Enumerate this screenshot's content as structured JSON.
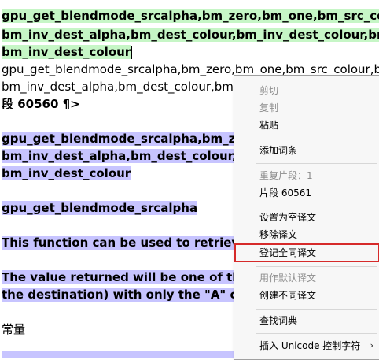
{
  "document": {
    "lines": [
      {
        "text": "gpu_get_blendmode_srcalpha,bm_zero,bm_one,bm_src_colo",
        "style": "bold-green"
      },
      {
        "text": "bm_inv_dest_alpha,bm_dest_colour,bm_inv_dest_colour,bm",
        "style": "bold-green"
      },
      {
        "text": "bm_inv_dest_colour",
        "style": "bold-green"
      },
      {
        "text": "gpu_get_blendmode_srcalpha,bm_zero,bm_one,bm_src_colour,b",
        "style": "plain"
      },
      {
        "text": "bm_inv_dest_alpha,bm_dest_colour,bm",
        "style": "plain"
      },
      {
        "text": "段 60560 ¶>",
        "style": "bold"
      },
      {
        "text": "gpu_get_blendmode_srcalpha,bm_ze",
        "style": "bold-purple"
      },
      {
        "text": "bm_inv_dest_alpha,bm_dest_colour,b",
        "style": "bold-purple"
      },
      {
        "text": "bm_inv_dest_colour",
        "style": "bold-purple"
      },
      {
        "text": "gpu_get_blendmode_srcalpha",
        "style": "bold-purple"
      },
      {
        "text": "This function can be used to retrieve",
        "style": "bold-purple"
      },
      {
        "text": "The value returned will be one of the",
        "style": "bold-purple"
      },
      {
        "text": "the destination) with only the \"A\" co",
        "style": "bold-purple"
      },
      {
        "text": "常量",
        "style": "plain"
      }
    ]
  },
  "context_menu": {
    "items": [
      {
        "label": "剪切",
        "disabled": true
      },
      {
        "label": "复制",
        "disabled": true
      },
      {
        "label": "粘贴",
        "disabled": false
      },
      {
        "label": "添加词条",
        "disabled": false
      },
      {
        "label": "重复片段：1",
        "disabled": true
      },
      {
        "label": "片段 60561",
        "disabled": false
      },
      {
        "label": "设置为空译文",
        "disabled": false
      },
      {
        "label": "移除译文",
        "disabled": false
      },
      {
        "label": "登记全同译文",
        "disabled": false,
        "highlighted": true
      },
      {
        "label": "用作默认译文",
        "disabled": true
      },
      {
        "label": "创建不同译文",
        "disabled": false
      },
      {
        "label": "查找词典",
        "disabled": false
      },
      {
        "label": "插入 Unicode 控制字符",
        "disabled": false,
        "submenu": true
      }
    ],
    "submenu_arrow": "›"
  }
}
